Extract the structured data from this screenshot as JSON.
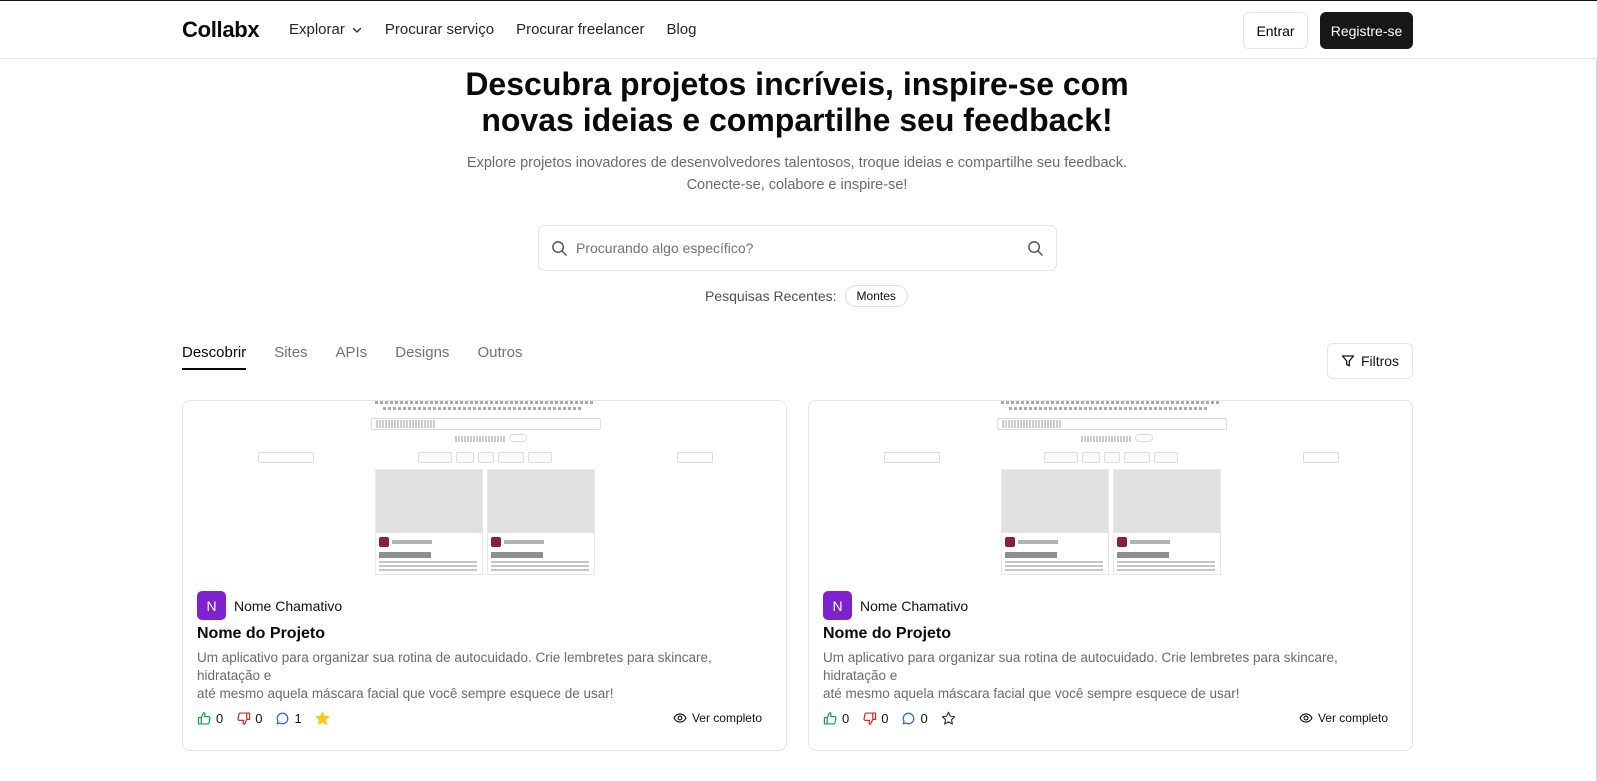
{
  "header": {
    "logo": "Collabx",
    "nav": [
      "Explorar",
      "Procurar serviço",
      "Procurar freelancer",
      "Blog"
    ],
    "login_label": "Entrar",
    "register_label": "Registre-se"
  },
  "hero": {
    "title_line1": "Descubra projetos incríveis, inspire-se com",
    "title_line2": "novas ideias e compartilhe seu feedback!",
    "subtitle_line1": "Explore projetos inovadores de desenvolvedores talentosos, troque ideias e compartilhe seu feedback.",
    "subtitle_line2": "Conecte-se, colabore e inspire-se!"
  },
  "search": {
    "placeholder": "Procurando algo específico?",
    "value": ""
  },
  "recent": {
    "label": "Pesquisas Recentes:",
    "items": [
      "Montes"
    ]
  },
  "tabs": [
    "Descobrir",
    "Sites",
    "APIs",
    "Designs",
    "Outros"
  ],
  "active_tab": "Descobrir",
  "filters_label": "Filtros",
  "cards": [
    {
      "avatar_letter": "N",
      "author": "Nome Chamativo",
      "title": "Nome do Projeto",
      "description_line1": "Um aplicativo para organizar sua rotina de autocuidado. Crie lembretes para skincare, hidratação e",
      "description_line2": "até mesmo aquela máscara facial que você sempre esquece de usar!",
      "likes": "0",
      "dislikes": "0",
      "comments": "1",
      "favorited": true,
      "view_label": "Ver completo"
    },
    {
      "avatar_letter": "N",
      "author": "Nome Chamativo",
      "title": "Nome do Projeto",
      "description_line1": "Um aplicativo para organizar sua rotina de autocuidado. Crie lembretes para skincare, hidratação e",
      "description_line2": "até mesmo aquela máscara facial que você sempre esquece de usar!",
      "likes": "0",
      "dislikes": "0",
      "comments": "0",
      "favorited": false,
      "view_label": "Ver completo"
    }
  ],
  "colors": {
    "primary": "#171717",
    "avatar": "#7e22ce",
    "like": "#16a34a",
    "dislike": "#dc2626",
    "comment": "#2563eb",
    "star": "#facc15"
  }
}
